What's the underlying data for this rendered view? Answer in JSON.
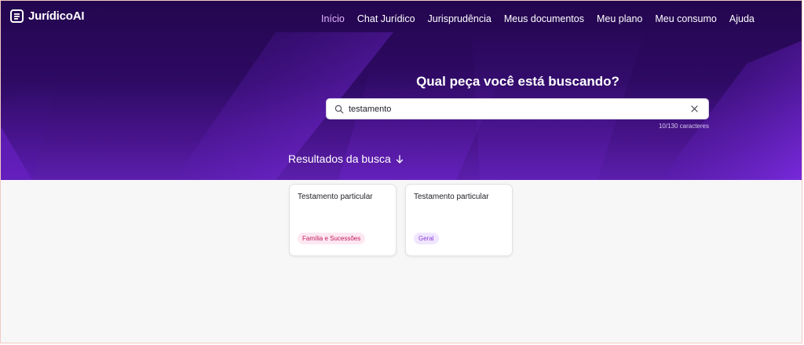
{
  "brand": {
    "name": "JurídicoAI"
  },
  "nav": {
    "items": [
      {
        "label": "Início",
        "active": true
      },
      {
        "label": "Chat Jurídico",
        "active": false
      },
      {
        "label": "Jurisprudência",
        "active": false
      },
      {
        "label": "Meus documentos",
        "active": false
      },
      {
        "label": "Meu plano",
        "active": false
      },
      {
        "label": "Meu consumo",
        "active": false
      },
      {
        "label": "Ajuda",
        "active": false
      }
    ]
  },
  "hero": {
    "headline": "Qual peça você está buscando?"
  },
  "search": {
    "value": "testamento",
    "counter": "10/130 caracteres"
  },
  "results": {
    "title": "Resultados da busca",
    "cards": [
      {
        "title": "Testamento particular",
        "tag": "Família e Sucessões",
        "tag_color": "#c2185b"
      },
      {
        "title": "Testamento particular",
        "tag": "Geral",
        "tag_color": "#8b3fd9"
      }
    ]
  },
  "colors": {
    "hero_dark": "#23064f",
    "hero_accent": "#7a2be0",
    "nav_active": "#e6b6ff"
  }
}
